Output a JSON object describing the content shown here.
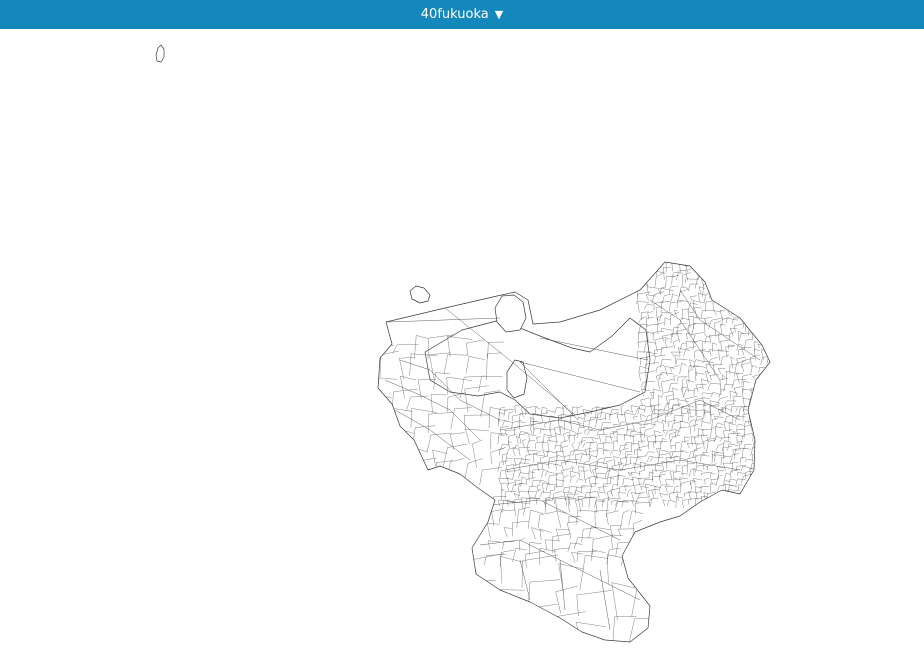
{
  "header": {
    "dataset_label": "40fukuoka",
    "caret": "▼",
    "bar_color": "#1487bd"
  },
  "map": {
    "stroke_color": "#3a3a3a",
    "fill_color": "#ffffff"
  }
}
